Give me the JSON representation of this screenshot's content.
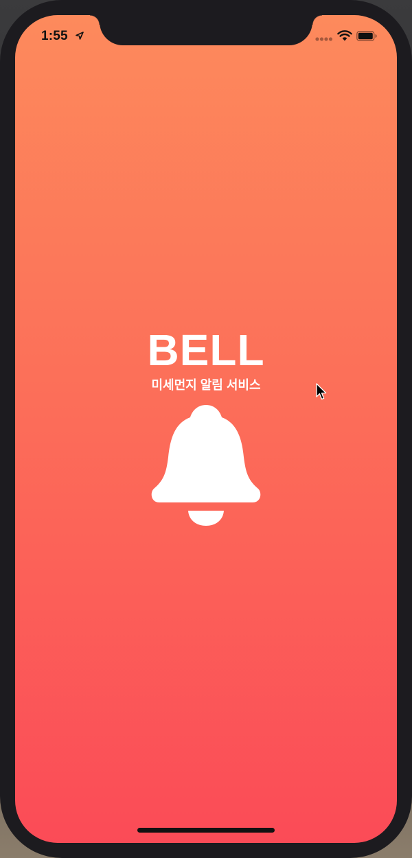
{
  "status_bar": {
    "time": "1:55",
    "location_icon": "location-arrow-icon",
    "signal_icon": "signal-dots-icon",
    "wifi_icon": "wifi-icon",
    "battery_icon": "battery-icon"
  },
  "splash": {
    "title": "BELL",
    "subtitle": "미세먼지 알림 서비스",
    "icon": "bell-icon"
  },
  "colors": {
    "gradient_top": "#fd8a5c",
    "gradient_bottom": "#fb4b57",
    "text": "#ffffff",
    "bezel": "#1c1b1f"
  }
}
